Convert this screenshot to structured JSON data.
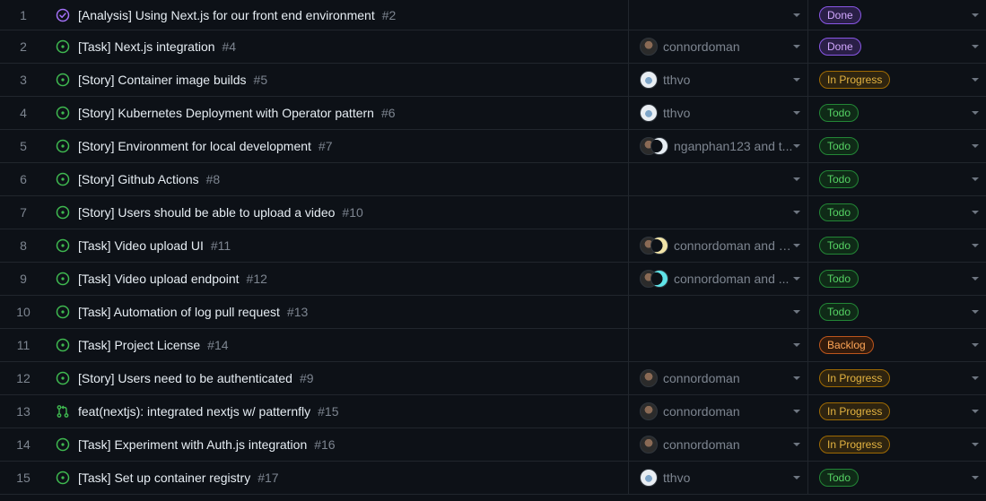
{
  "rows": [
    {
      "num": "1",
      "type": "done",
      "title": "[Analysis] Using Next.js for our front end environment",
      "issue": "#2",
      "assignee": "",
      "avatars": [],
      "status": "Done"
    },
    {
      "num": "2",
      "type": "open",
      "title": "[Task] Next.js integration",
      "issue": "#4",
      "assignee": "connordoman",
      "avatars": [
        "dark"
      ],
      "status": "Done"
    },
    {
      "num": "3",
      "type": "open",
      "title": "[Story] Container image builds",
      "issue": "#5",
      "assignee": "tthvo",
      "avatars": [
        "light"
      ],
      "status": "In Progress"
    },
    {
      "num": "4",
      "type": "open",
      "title": "[Story] Kubernetes Deployment with Operator pattern",
      "issue": "#6",
      "assignee": "tthvo",
      "avatars": [
        "light"
      ],
      "status": "Todo"
    },
    {
      "num": "5",
      "type": "open",
      "title": "[Story] Environment for local development",
      "issue": "#7",
      "assignee": "nganphan123 and t...",
      "avatars": [
        "dark",
        "white2"
      ],
      "status": "Todo"
    },
    {
      "num": "6",
      "type": "open",
      "title": "[Story] Github Actions",
      "issue": "#8",
      "assignee": "",
      "avatars": [],
      "status": "Todo"
    },
    {
      "num": "7",
      "type": "open",
      "title": "[Story] Users should be able to upload a video",
      "issue": "#10",
      "assignee": "",
      "avatars": [],
      "status": "Todo"
    },
    {
      "num": "8",
      "type": "open",
      "title": "[Task] Video upload UI",
      "issue": "#11",
      "assignee": "connordoman and li...",
      "avatars": [
        "dark",
        "moon"
      ],
      "status": "Todo"
    },
    {
      "num": "9",
      "type": "open",
      "title": "[Task] Video upload endpoint",
      "issue": "#12",
      "assignee": "connordoman and ...",
      "avatars": [
        "dark",
        "cyan"
      ],
      "status": "Todo"
    },
    {
      "num": "10",
      "type": "open",
      "title": "[Task] Automation of log pull request",
      "issue": "#13",
      "assignee": "",
      "avatars": [],
      "status": "Todo"
    },
    {
      "num": "11",
      "type": "open",
      "title": "[Task] Project License",
      "issue": "#14",
      "assignee": "",
      "avatars": [],
      "status": "Backlog"
    },
    {
      "num": "12",
      "type": "open",
      "title": "[Story] Users need to be authenticated",
      "issue": "#9",
      "assignee": "connordoman",
      "avatars": [
        "dark"
      ],
      "status": "In Progress"
    },
    {
      "num": "13",
      "type": "pr",
      "title": "feat(nextjs): integrated nextjs w/ patternfly",
      "issue": "#15",
      "assignee": "connordoman",
      "avatars": [
        "dark"
      ],
      "status": "In Progress"
    },
    {
      "num": "14",
      "type": "open",
      "title": "[Task] Experiment with Auth.js integration",
      "issue": "#16",
      "assignee": "connordoman",
      "avatars": [
        "dark"
      ],
      "status": "In Progress"
    },
    {
      "num": "15",
      "type": "open",
      "title": "[Task] Set up container registry",
      "issue": "#17",
      "assignee": "tthvo",
      "avatars": [
        "light"
      ],
      "status": "Todo"
    }
  ],
  "status_colors": {
    "Done": {
      "fg": "#d2a8ff",
      "bg": "#2a1f47",
      "border": "#8957e5"
    },
    "In Progress": {
      "fg": "#e3b341",
      "bg": "#2e2410",
      "border": "#9e6a03"
    },
    "Todo": {
      "fg": "#56d364",
      "bg": "#0f2a17",
      "border": "#238636"
    },
    "Backlog": {
      "fg": "#ffa657",
      "bg": "#331b0c",
      "border": "#bd561d"
    }
  },
  "icon_colors": {
    "open": "#3fb950",
    "done": "#a371f7",
    "pr": "#3fb950"
  },
  "icon_names": {
    "open": "issue-opened-icon",
    "done": "issue-closed-icon",
    "pr": "pull-request-icon"
  }
}
